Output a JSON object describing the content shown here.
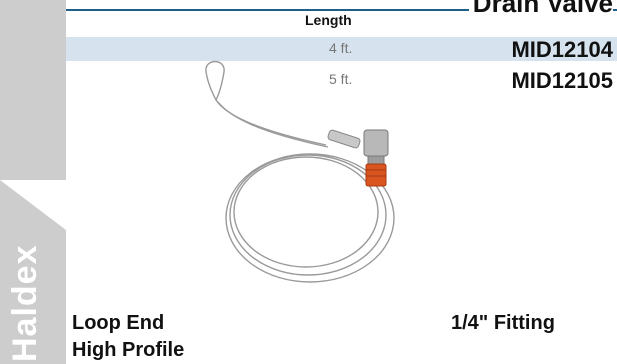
{
  "section": {
    "title": "Drain Valve"
  },
  "brand": {
    "vertical_label": "Haldex"
  },
  "table": {
    "header": "Length",
    "rows": [
      {
        "length": "4 ft.",
        "part": "MID12104"
      },
      {
        "length": "5 ft.",
        "part": "MID12105"
      }
    ]
  },
  "captions": {
    "end_type": "Loop End",
    "profile": "High Profile",
    "fitting": "1/4\" Fitting"
  },
  "colors": {
    "accent_rule": "#1d5f86",
    "row_highlight": "#d6e3ee",
    "side_band": "#cdcdcd",
    "fitting_orange": "#d9541e"
  }
}
